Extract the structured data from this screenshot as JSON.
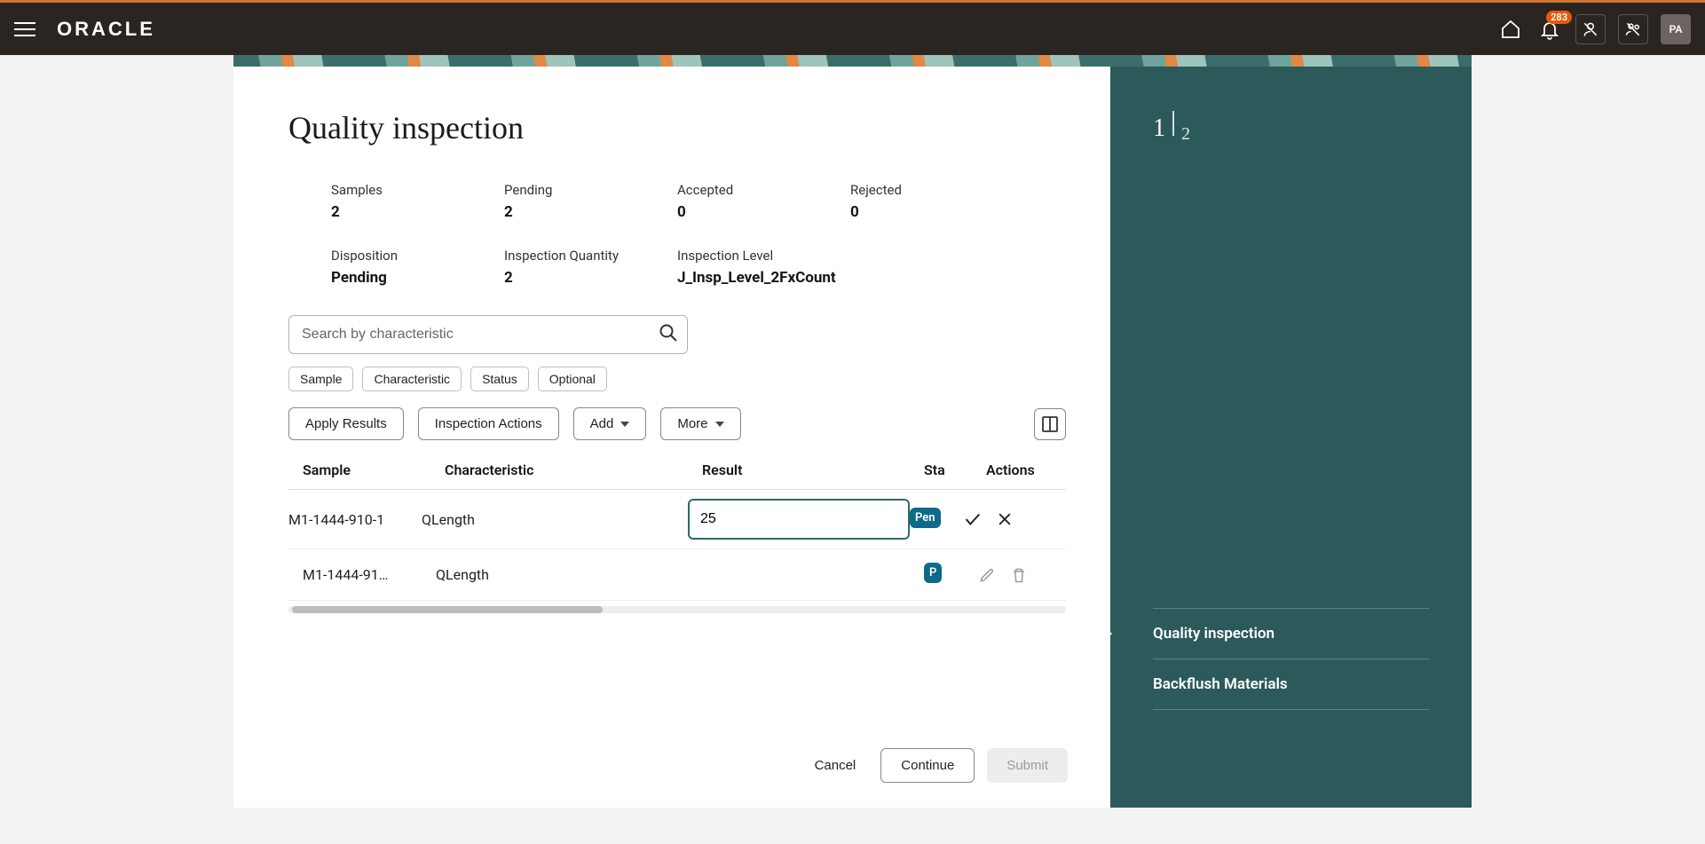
{
  "header": {
    "logo_text": "ORACLE",
    "notification_count": "283",
    "avatar_initials": "PA"
  },
  "progress": {
    "current": "1",
    "total": "2"
  },
  "page": {
    "title": "Quality inspection"
  },
  "summary": {
    "samples": {
      "label": "Samples",
      "value": "2"
    },
    "pending": {
      "label": "Pending",
      "value": "2"
    },
    "accepted": {
      "label": "Accepted",
      "value": "0"
    },
    "rejected": {
      "label": "Rejected",
      "value": "0"
    },
    "disposition": {
      "label": "Disposition",
      "value": "Pending"
    },
    "inspection_quantity": {
      "label": "Inspection Quantity",
      "value": "2"
    },
    "inspection_level": {
      "label": "Inspection Level",
      "value": "J_Insp_Level_2FxCount"
    }
  },
  "search": {
    "placeholder": "Search by characteristic",
    "value": ""
  },
  "chips": [
    "Sample",
    "Characteristic",
    "Status",
    "Optional"
  ],
  "toolbar": {
    "apply_results": "Apply Results",
    "inspection_actions": "Inspection Actions",
    "add": "Add",
    "more": "More"
  },
  "table": {
    "columns": {
      "sample": "Sample",
      "characteristic": "Characteristic",
      "result": "Result",
      "status": "Sta",
      "actions": "Actions"
    },
    "rows": [
      {
        "sample": "M1-1444-910-1",
        "characteristic": "QLength",
        "result": "25",
        "status": "Pen",
        "mode": "edit"
      },
      {
        "sample": "M1-1444-91…",
        "characteristic": "QLength",
        "result": "",
        "status": "P",
        "mode": "view"
      }
    ]
  },
  "footer": {
    "cancel": "Cancel",
    "continue": "Continue",
    "submit": "Submit"
  },
  "side_steps": [
    "Quality inspection",
    "Backflush Materials"
  ]
}
